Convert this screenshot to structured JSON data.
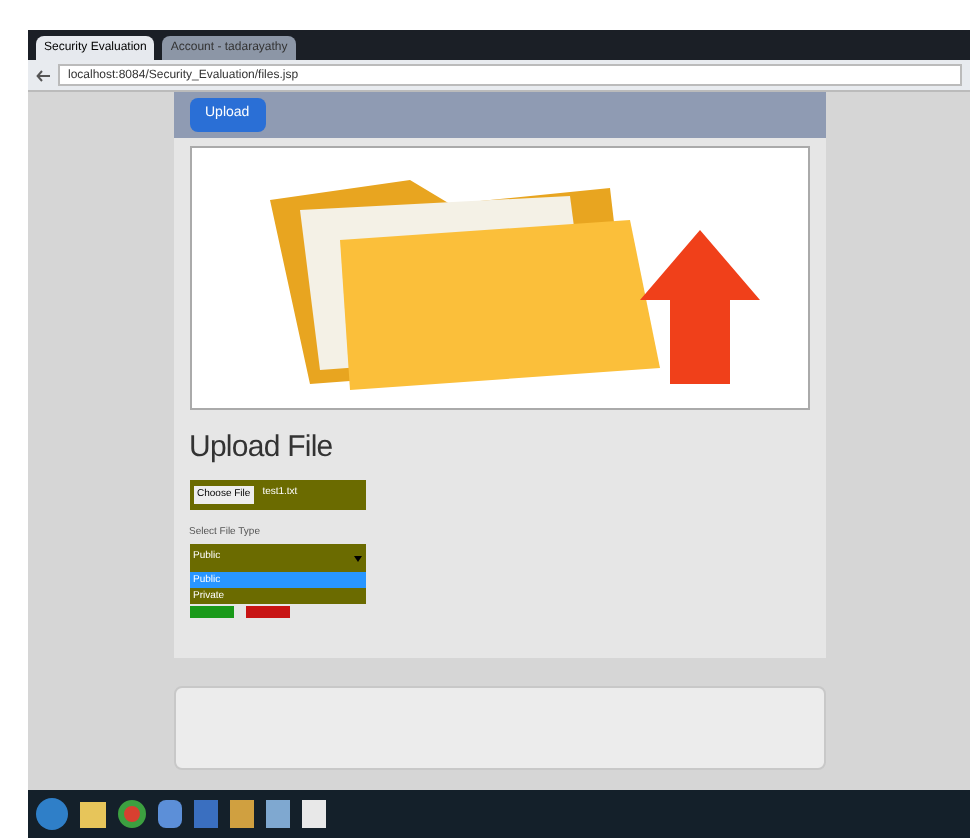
{
  "browser": {
    "tabs": [
      {
        "label": "Security Evaluation",
        "selected": true
      },
      {
        "label": "Account - tadarayathy",
        "selected": false
      }
    ],
    "address": "localhost:8084/Security_Evaluation/files.jsp"
  },
  "nav": {
    "items": [
      {
        "label": "Upload",
        "selected": true
      }
    ]
  },
  "upload": {
    "heading": "Upload File",
    "choose_button": "Choose File",
    "file_name": "test1.txt",
    "type_label": "Select File Type",
    "type_value": "Public",
    "options": [
      {
        "label": "Public",
        "selected": true
      },
      {
        "label": "Private",
        "selected": false
      }
    ]
  }
}
